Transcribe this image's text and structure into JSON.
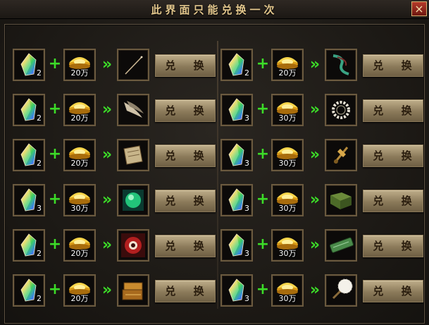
{
  "window": {
    "title": "此界面只能兑换一次",
    "close_label": "×"
  },
  "exchange_label": "兑 换",
  "plus_symbol": "+",
  "arrow_symbol": "»",
  "columns": [
    {
      "rows": [
        {
          "gem_qty": "2",
          "gold_amount": "20万",
          "reward_icon": "thin-needle-icon"
        },
        {
          "gem_qty": "2",
          "gold_amount": "20万",
          "reward_icon": "claw-horns-icon"
        },
        {
          "gem_qty": "2",
          "gold_amount": "20万",
          "reward_icon": "scroll-icon"
        },
        {
          "gem_qty": "3",
          "gold_amount": "30万",
          "reward_icon": "green-orb-icon"
        },
        {
          "gem_qty": "2",
          "gold_amount": "20万",
          "reward_icon": "red-eye-icon"
        },
        {
          "gem_qty": "2",
          "gold_amount": "20万",
          "reward_icon": "treasure-books-icon"
        }
      ]
    },
    {
      "rows": [
        {
          "gem_qty": "2",
          "gold_amount": "20万",
          "reward_icon": "green-ribbon-icon"
        },
        {
          "gem_qty": "3",
          "gold_amount": "30万",
          "reward_icon": "pearl-ring-icon"
        },
        {
          "gem_qty": "3",
          "gold_amount": "30万",
          "reward_icon": "golden-talisman-icon"
        },
        {
          "gem_qty": "3",
          "gold_amount": "30万",
          "reward_icon": "green-book-icon"
        },
        {
          "gem_qty": "3",
          "gold_amount": "30万",
          "reward_icon": "jade-tube-icon"
        },
        {
          "gem_qty": "3",
          "gold_amount": "30万",
          "reward_icon": "feather-fan-icon"
        }
      ]
    }
  ],
  "colors": {
    "accent_green": "#3cdc28",
    "title_gold": "#e2c68c",
    "slot_border": "#6b5a3f"
  }
}
